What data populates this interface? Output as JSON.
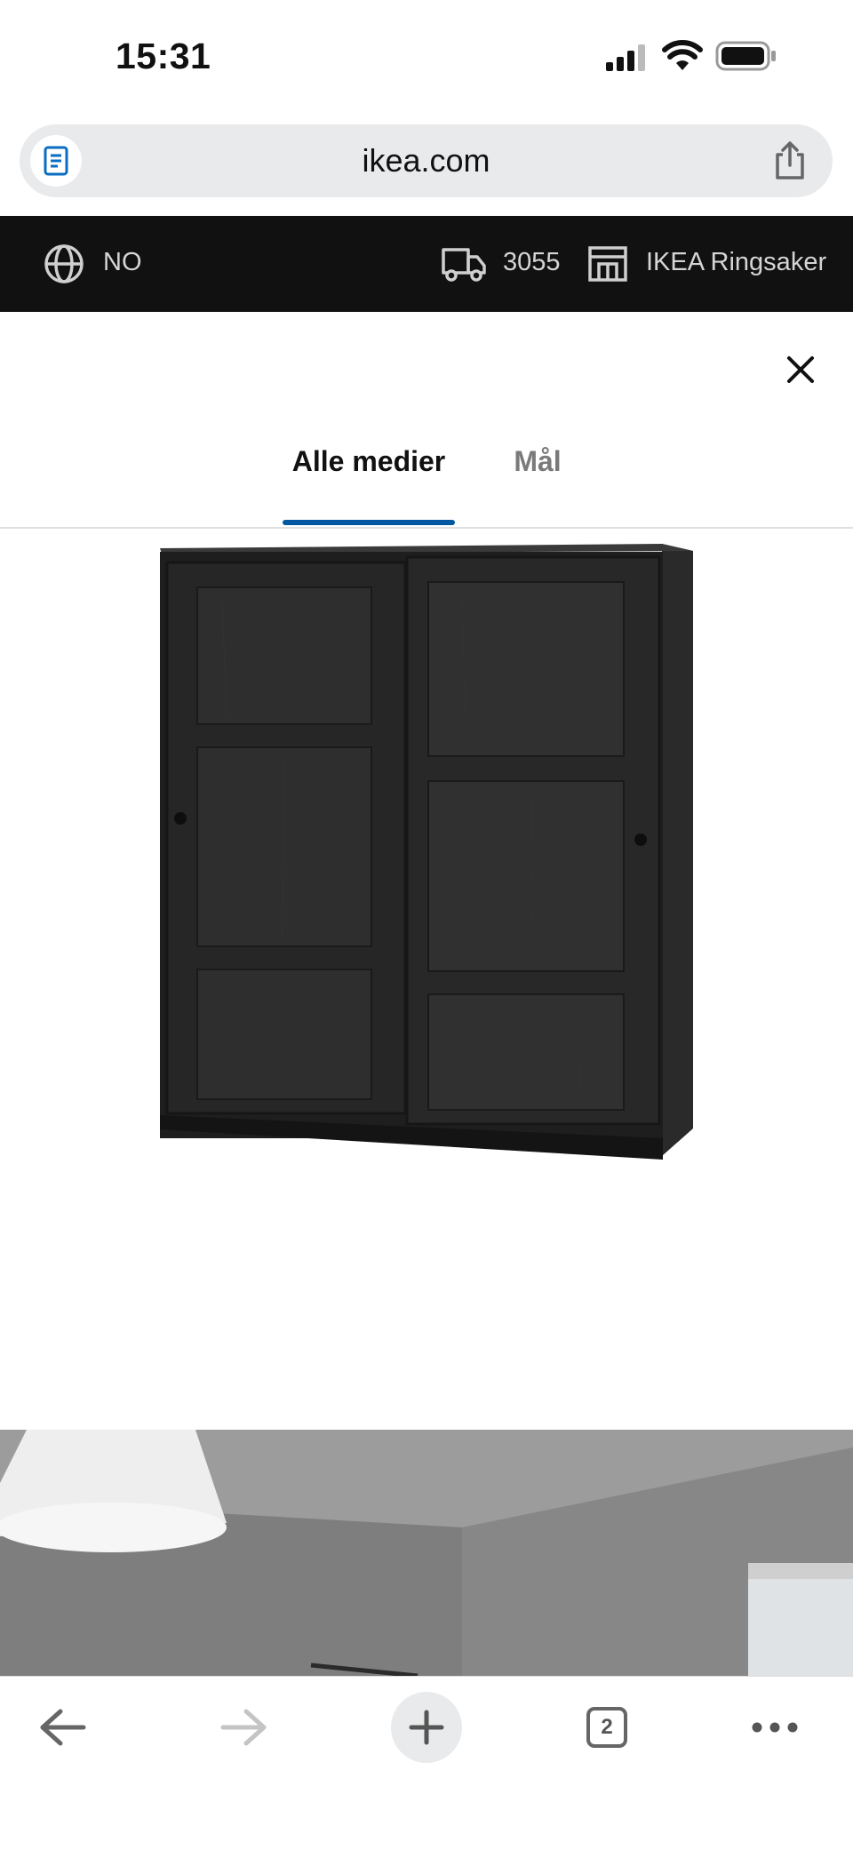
{
  "status_bar": {
    "time": "15:31"
  },
  "browser": {
    "url": "ikea.com",
    "open_tabs_count": "2"
  },
  "ikea_nav": {
    "locale": "NO",
    "postcode": "3055",
    "store": "IKEA Ringsaker"
  },
  "media_sheet": {
    "tabs": [
      {
        "label": "Alle medier",
        "active": true
      },
      {
        "label": "Mål",
        "active": false
      }
    ]
  },
  "colors": {
    "nav_background": "#111111",
    "active_tab_indicator": "#0058a3"
  },
  "icons": {
    "reader": "reader-icon",
    "share": "share-icon",
    "globe": "globe-icon",
    "delivery": "truck-icon",
    "store": "store-icon",
    "close": "close-icon",
    "back": "back-arrow-icon",
    "forward": "forward-arrow-icon",
    "new_tab": "plus-icon",
    "tabs": "tabs-icon",
    "more": "more-icon"
  }
}
